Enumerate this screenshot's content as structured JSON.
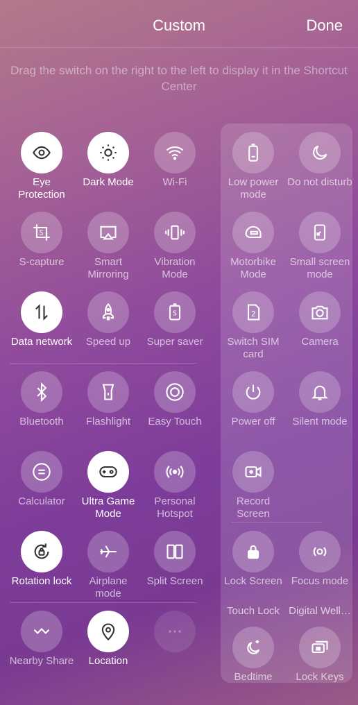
{
  "header": {
    "title": "Custom",
    "done_label": "Done"
  },
  "instruction": "Drag the switch on the right to the left to display it in the Shortcut Center",
  "left_tiles": [
    {
      "label": "Eye Protection",
      "icon": "eye-icon",
      "active": true
    },
    {
      "label": "Dark Mode",
      "icon": "dark-mode-icon",
      "active": true
    },
    {
      "label": "Wi-Fi",
      "icon": "wifi-icon",
      "active": false
    },
    {
      "label": "S-capture",
      "icon": "s-capture-icon",
      "active": false
    },
    {
      "label": "Smart Mirroring",
      "icon": "screen-mirror-icon",
      "active": false
    },
    {
      "label": "Vibration Mode",
      "icon": "vibration-icon",
      "active": false
    },
    {
      "label": "Data network",
      "icon": "data-arrows-icon",
      "active": true
    },
    {
      "label": "Speed up",
      "icon": "rocket-icon",
      "active": false
    },
    {
      "label": "Super saver",
      "icon": "super-saver-icon",
      "active": false
    },
    {
      "label": "Bluetooth",
      "icon": "bluetooth-icon",
      "active": false
    },
    {
      "label": "Flashlight",
      "icon": "flashlight-icon",
      "active": false
    },
    {
      "label": "Easy Touch",
      "icon": "easy-touch-icon",
      "active": false
    },
    {
      "label": "Calculator",
      "icon": "calculator-icon",
      "active": false
    },
    {
      "label": "Ultra Game Mode",
      "icon": "gamepad-icon",
      "active": true
    },
    {
      "label": "Personal Hotspot",
      "icon": "hotspot-icon",
      "active": false
    },
    {
      "label": "Rotation lock",
      "icon": "rotation-lock-icon",
      "active": true
    },
    {
      "label": "Airplane mode",
      "icon": "airplane-icon",
      "active": false
    },
    {
      "label": "Split Screen",
      "icon": "split-screen-icon",
      "active": false
    },
    {
      "label": "Nearby Share",
      "icon": "nearby-share-icon",
      "active": false
    },
    {
      "label": "Location",
      "icon": "location-icon",
      "active": true
    }
  ],
  "right_tiles": [
    {
      "label": "Low power mode",
      "icon": "battery-icon"
    },
    {
      "label": "Do not disturb",
      "icon": "moon-icon"
    },
    {
      "label": "Motorbike Mode",
      "icon": "helmet-icon"
    },
    {
      "label": "Small screen mode",
      "icon": "small-screen-icon"
    },
    {
      "label": "Switch SIM card",
      "icon": "sim-icon"
    },
    {
      "label": "Camera",
      "icon": "camera-icon"
    },
    {
      "label": "Power off",
      "icon": "power-icon"
    },
    {
      "label": "Silent mode",
      "icon": "bell-icon"
    },
    {
      "label": "Record Screen",
      "icon": "record-screen-icon"
    },
    {
      "label": "Lock Screen",
      "icon": "lock-icon"
    },
    {
      "label": "Focus mode",
      "icon": "focus-icon"
    },
    {
      "label": "Bedtime",
      "icon": "bedtime-icon"
    },
    {
      "label": "Lock Keys",
      "icon": "lock-keys-icon"
    }
  ],
  "right_text_row": {
    "left": "Touch Lock",
    "right": "Digital Well…"
  }
}
